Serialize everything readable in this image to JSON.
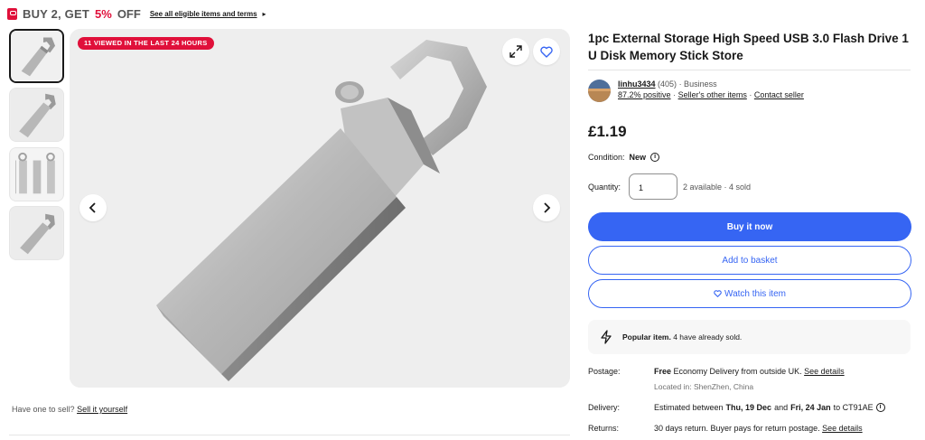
{
  "promo": {
    "prefix": "BUY 2, GET",
    "percent": "5%",
    "suffix": "OFF",
    "link": "See all eligible items and terms",
    "accent": "#e0103a"
  },
  "gallery": {
    "viewed_badge": "11 VIEWED IN THE LAST 24 HOURS",
    "thumbnails": [
      "usb-drive-front",
      "usb-drive-angle",
      "usb-drive-dimensions",
      "usb-drive-side"
    ],
    "selected_thumbnail": 1
  },
  "sell": {
    "prompt": "Have one to sell?",
    "link": "Sell it yourself"
  },
  "listing": {
    "title": "1pc External Storage High Speed USB 3.0 Flash Drive 1 U Disk Memory Stick Store",
    "price": "£1.19"
  },
  "seller": {
    "name": "linhu3434",
    "feedback_count": "(405)",
    "type": "· Business",
    "positive": "87.2% positive",
    "other_items": "Seller's other items",
    "contact": "Contact seller"
  },
  "condition": {
    "label": "Condition:",
    "value": "New"
  },
  "quantity": {
    "label": "Quantity:",
    "value": "1",
    "availability": "2 available · 4 sold"
  },
  "actions": {
    "buy_now": "Buy it now",
    "add_to_basket": "Add to basket",
    "watch": "Watch this item",
    "primary_color": "#3665f3"
  },
  "popular": {
    "strong": "Popular item.",
    "text": "4 have already sold."
  },
  "postage": {
    "label": "Postage:",
    "free": "Free",
    "text": "Economy Delivery from outside UK.",
    "link": "See details",
    "location": "Located in: ShenZhen, China"
  },
  "delivery": {
    "label": "Delivery:",
    "prefix": "Estimated between",
    "start": "Thu, 19 Dec",
    "and": "and",
    "end": "Fri, 24 Jan",
    "suffix": "to CT91AE"
  },
  "returns": {
    "label": "Returns:",
    "text": "30 days return. Buyer pays for return postage.",
    "link": "See details"
  }
}
